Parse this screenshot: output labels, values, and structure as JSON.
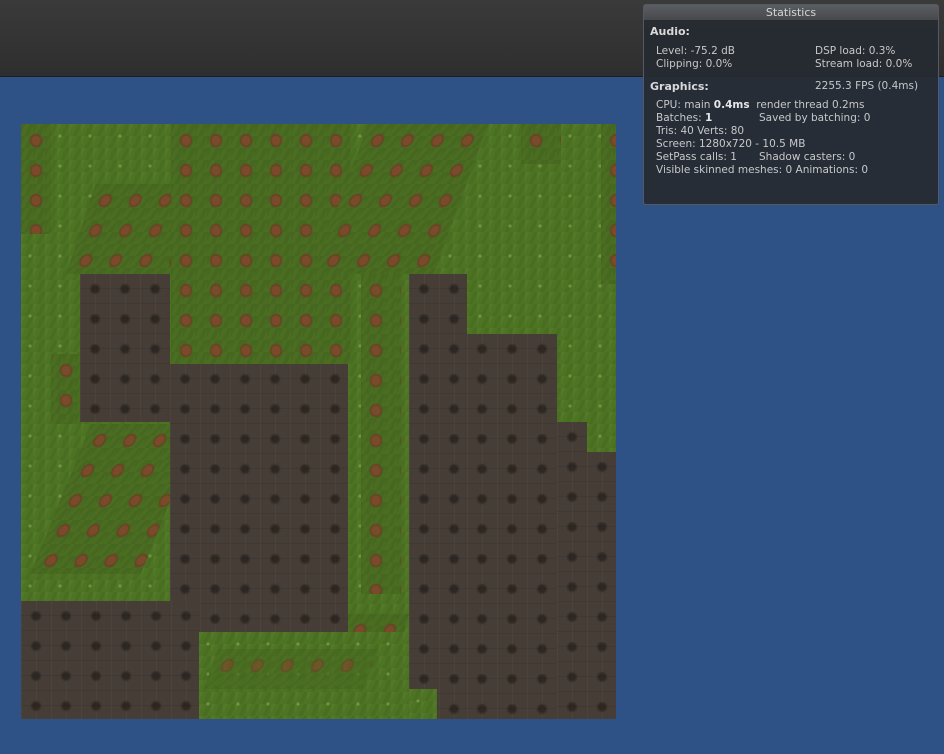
{
  "statistics": {
    "title": "Statistics",
    "audio": {
      "heading": "Audio:",
      "level": "Level: -75.2 dB",
      "dsp_load": "DSP load: 0.3%",
      "clipping": "Clipping: 0.0%",
      "stream_load": "Stream load: 0.0%"
    },
    "graphics": {
      "heading": "Graphics:",
      "fps": "2255.3 FPS (0.4ms)",
      "cpu_prefix": "CPU: main ",
      "cpu_main": "0.4ms",
      "cpu_render": "render thread 0.2ms",
      "batches_prefix": "Batches: ",
      "batches_value": "1",
      "saved_by_batching": "Saved by batching: 0",
      "tris_verts": "Tris: 40   Verts: 80",
      "screen": "Screen: 1280x720 - 10.5 MB",
      "setpass": "SetPass calls: 1",
      "shadow_casters": "Shadow casters: 0",
      "skinned_animations": "Visible skinned meshes: 0  Animations: 0"
    }
  },
  "colors": {
    "background": "#2f5286",
    "grass": "#4d7423",
    "dirt": "#453d36",
    "flower": "#7a4b2a"
  }
}
